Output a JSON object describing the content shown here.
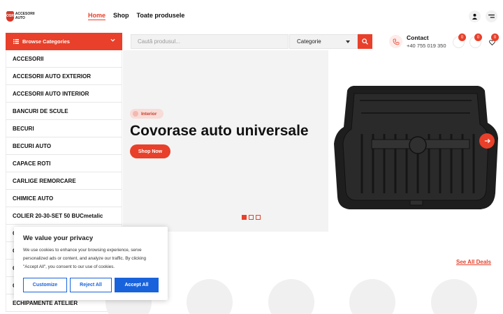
{
  "logo": {
    "badge": "OSR",
    "text_line1": "ACCESORII",
    "text_line2": "AUTO"
  },
  "nav": {
    "items": [
      "Home",
      "Shop",
      "Toate produsele"
    ]
  },
  "categories": {
    "header": "Browse Categories",
    "items": [
      "ACCESORII",
      "ACCESORII AUTO EXTERIOR",
      "ACCESORII AUTO INTERIOR",
      "BANCURI DE SCULE",
      "BECURI",
      "BECURI AUTO",
      "CAPACE ROTI",
      "CARLIGE REMORCARE",
      "CHIMICE AUTO",
      "COLIER 20-30-SET 50 BUCmetalic",
      "C",
      "C",
      "C",
      "C",
      "ECHIPAMENTE ATELIER"
    ]
  },
  "search": {
    "placeholder": "Caută produsul...",
    "category": "Categorie"
  },
  "contact": {
    "title": "Contact",
    "phone": "+40 755 019 350"
  },
  "badges": {
    "compare": "0",
    "cart": "0",
    "wishlist": "0"
  },
  "hero": {
    "tag": "Interior",
    "title": "Covorase auto universale",
    "button": "Shop Now",
    "active_slide": 1,
    "slide_count": 3
  },
  "deals": {
    "see_all": "See All Deals"
  },
  "cookie": {
    "title": "We value your privacy",
    "body": "We use cookies to enhance your browsing experience, serve personalized ads or content, and analyze our traffic. By clicking \"Accept All\", you consent to our use of cookies.",
    "customize": "Customize",
    "reject": "Reject All",
    "accept": "Accept All"
  },
  "colors": {
    "accent": "#e8402a",
    "cookie_blue": "#1863dc"
  }
}
